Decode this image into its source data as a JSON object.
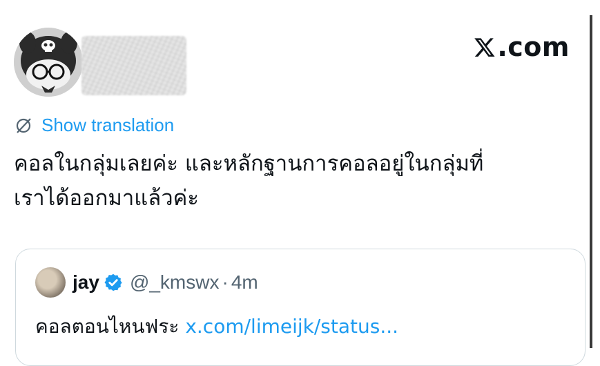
{
  "brand": {
    "logo_text": ".com",
    "logo_icon": "x-logo-icon"
  },
  "post": {
    "author_avatar_icon": "avatar-skull-plush",
    "translate_icon": "translate-globe-slash-icon",
    "translate_label": "Show translation",
    "text_line1": "คอลในกลุ่มเลยค่ะ และหลักฐานการคอลอยู่ในกลุ่มที่",
    "text_line2": "เราได้ออกมาแล้วค่ะ"
  },
  "quote": {
    "name": "jay",
    "verified_icon": "verified-badge-icon",
    "handle": "@_kmswx",
    "separator": "·",
    "time": "4m",
    "text": "คอลตอนไหนฟระ ",
    "link": "x.com/limeijk/status..."
  },
  "colors": {
    "link": "#1d9bf0",
    "muted": "#536471",
    "text": "#0f1419",
    "border": "#cfd9de"
  }
}
